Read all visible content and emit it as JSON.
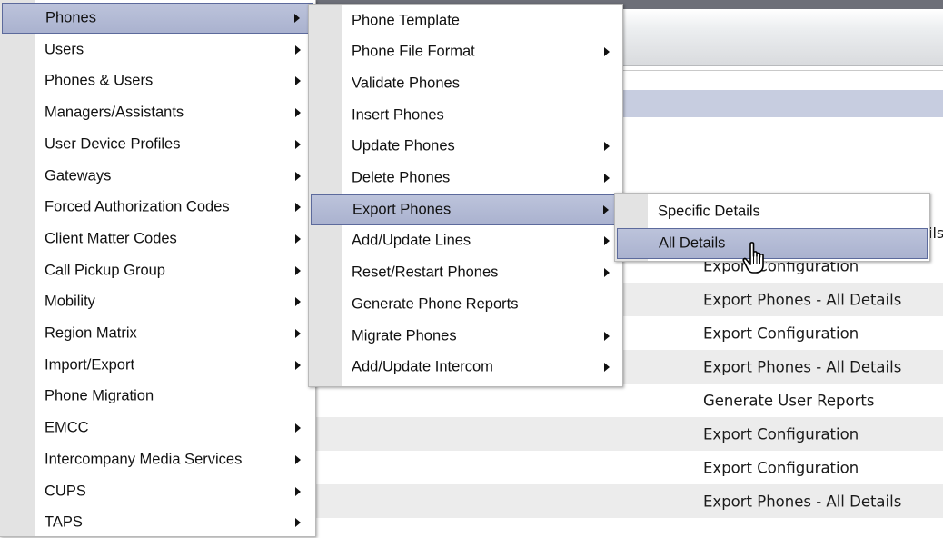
{
  "menu_level1": {
    "items": [
      {
        "label": "Phones",
        "submenu": true,
        "active": true
      },
      {
        "label": "Users",
        "submenu": true
      },
      {
        "label": "Phones & Users",
        "submenu": true
      },
      {
        "label": "Managers/Assistants",
        "submenu": true
      },
      {
        "label": "User Device Profiles",
        "submenu": true
      },
      {
        "label": "Gateways",
        "submenu": true
      },
      {
        "label": "Forced Authorization Codes",
        "submenu": true
      },
      {
        "label": "Client Matter Codes",
        "submenu": true
      },
      {
        "label": "Call Pickup Group",
        "submenu": true
      },
      {
        "label": "Mobility",
        "submenu": true
      },
      {
        "label": "Region Matrix",
        "submenu": true
      },
      {
        "label": "Import/Export",
        "submenu": true
      },
      {
        "label": "Phone Migration",
        "submenu": false
      },
      {
        "label": "EMCC",
        "submenu": true
      },
      {
        "label": "Intercompany Media Services",
        "submenu": true
      },
      {
        "label": "CUPS",
        "submenu": true
      },
      {
        "label": "TAPS",
        "submenu": true
      }
    ]
  },
  "menu_level2": {
    "items": [
      {
        "label": "Phone Template",
        "submenu": false
      },
      {
        "label": "Phone File Format",
        "submenu": true
      },
      {
        "label": "Validate Phones",
        "submenu": false
      },
      {
        "label": "Insert Phones",
        "submenu": false
      },
      {
        "label": "Update Phones",
        "submenu": true
      },
      {
        "label": "Delete Phones",
        "submenu": true
      },
      {
        "label": "Export Phones",
        "submenu": true,
        "active": true
      },
      {
        "label": "Add/Update Lines",
        "submenu": true
      },
      {
        "label": "Reset/Restart Phones",
        "submenu": true
      },
      {
        "label": "Generate Phone Reports",
        "submenu": false
      },
      {
        "label": "Migrate Phones",
        "submenu": true
      },
      {
        "label": "Add/Update Intercom",
        "submenu": true
      }
    ]
  },
  "menu_level3": {
    "items": [
      {
        "label": "Specific Details"
      },
      {
        "label": "All Details",
        "active": true
      }
    ]
  },
  "background": {
    "clipped_text": "ils",
    "rows": [
      {
        "text": "Export Configuration",
        "alt": false
      },
      {
        "text": "Export Phones - All Details",
        "alt": true
      },
      {
        "text": "Export Configuration",
        "alt": false
      },
      {
        "text": "Export Phones - All Details",
        "alt": true
      },
      {
        "text": "Generate User Reports",
        "alt": false
      },
      {
        "text": "Export Configuration",
        "alt": true
      },
      {
        "text": "Export Configuration",
        "alt": false
      },
      {
        "text": "Export Phones - All Details",
        "alt": true
      }
    ]
  },
  "colors": {
    "highlight": "#b3bad5",
    "highlight_border": "#5c6a9c",
    "gutter": "#e3e3e3",
    "row_alt": "#ececec",
    "band": "#c7cde0"
  },
  "icons": {
    "submenu_arrow": "triangle-right",
    "cursor": "hand-pointer"
  }
}
